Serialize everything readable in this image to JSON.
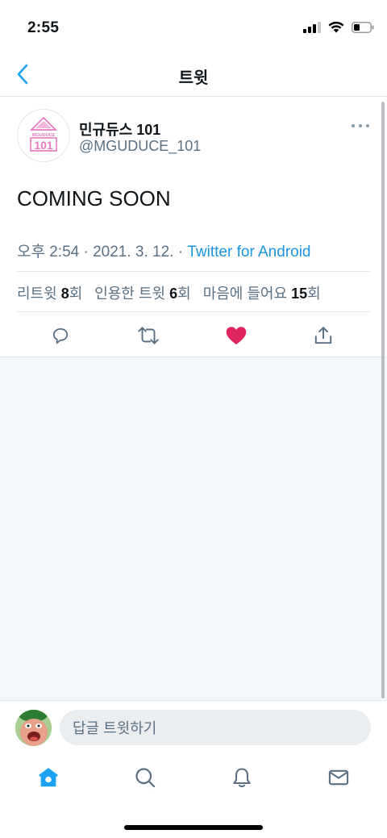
{
  "status_bar": {
    "time": "2:55"
  },
  "nav": {
    "title": "트윗"
  },
  "tweet": {
    "author": {
      "display_name": "민규듀스 101",
      "handle": "@MGUDUCE_101",
      "logo_text_top": "MGUDUCE",
      "logo_text_bottom": "101"
    },
    "text": "COMING SOON",
    "time": "오후 2:54",
    "separator": " · ",
    "date": "2021. 3. 12.",
    "source": "Twitter for Android",
    "stats": {
      "retweets_label": "리트윗 ",
      "retweets_count": "8",
      "retweets_unit": "회",
      "quotes_label": "인용한 트윗 ",
      "quotes_count": "6",
      "quotes_unit": "회",
      "likes_label": "마음에 들어요 ",
      "likes_count": "15",
      "likes_unit": "회"
    },
    "liked": true
  },
  "reply": {
    "placeholder": "답글 트윗하기"
  },
  "tabs": [
    "home-icon",
    "search-icon",
    "notifications-icon",
    "messages-icon"
  ],
  "colors": {
    "accent": "#1da1f2",
    "link": "#1b95e0",
    "like": "#e0245e",
    "secondary_text": "#5b7083",
    "logo_pink": "#e879c3"
  }
}
